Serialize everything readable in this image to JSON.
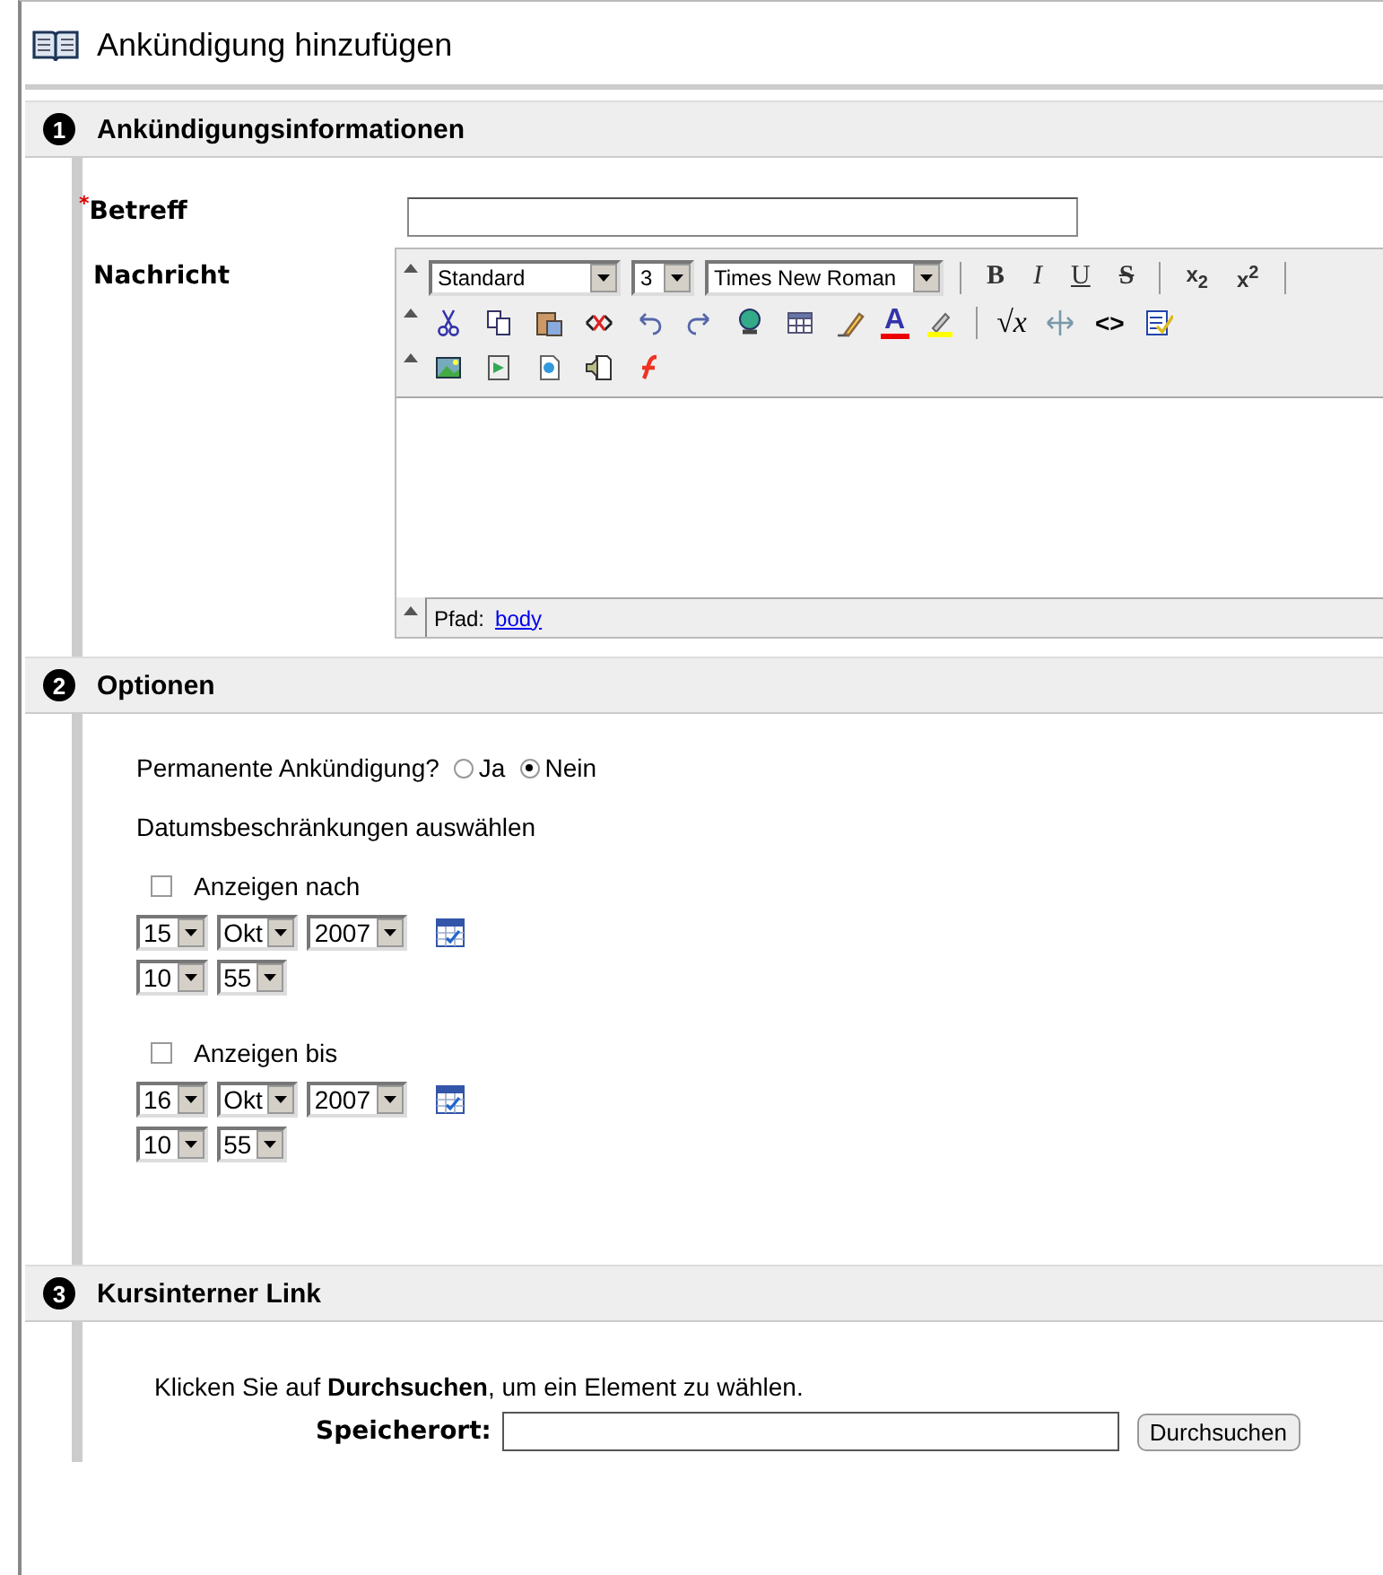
{
  "page": {
    "title": "Ankündigung hinzufügen"
  },
  "sections": [
    {
      "number": "1",
      "title": "Ankündigungsinformationen"
    },
    {
      "number": "2",
      "title": "Optionen"
    },
    {
      "number": "3",
      "title": "Kursinterner Link"
    }
  ],
  "info": {
    "subject": {
      "label": "Betreff",
      "required_mark": "*"
    },
    "message": {
      "label": "Nachricht",
      "format_selects": [
        {
          "value": "Standard"
        },
        {
          "value": "3"
        },
        {
          "value": "Times New Roman"
        }
      ],
      "style_buttons": [
        {
          "kind": "bold",
          "label": "B"
        },
        {
          "kind": "italic",
          "label": "I"
        },
        {
          "kind": "underline",
          "label": "U"
        },
        {
          "kind": "strike",
          "label": "S"
        },
        {
          "kind": "sep"
        },
        {
          "kind": "script",
          "label": "x$_{2}$"
        },
        {
          "kind": "script",
          "label": "x$^{2}$"
        }
      ],
      "row2": [
        {
          "kind": "cut"
        },
        {
          "kind": "copy"
        },
        {
          "kind": "paste"
        },
        {
          "kind": "remove"
        },
        {
          "kind": "undo"
        },
        {
          "kind": "redo"
        },
        {
          "kind": "link"
        },
        {
          "kind": "table"
        },
        {
          "kind": "pen"
        },
        {
          "kind": "fontcolor",
          "label": "A"
        },
        {
          "kind": "highlight"
        },
        {
          "kind": "sep"
        },
        {
          "kind": "math",
          "label": "√x"
        },
        {
          "kind": "anchor"
        },
        {
          "kind": "code",
          "label": "<>"
        },
        {
          "kind": "spell"
        }
      ],
      "row3": [
        {
          "kind": "image"
        },
        {
          "kind": "media"
        },
        {
          "kind": "preview"
        },
        {
          "kind": "audio"
        },
        {
          "kind": "flash"
        }
      ],
      "path_label": "Pfad:",
      "path_link": "body"
    }
  },
  "options": {
    "permanent_label": "Permanente Ankündigung?",
    "permanent_choices": [
      {
        "label": "Ja",
        "selected": false
      },
      {
        "label": "Nein",
        "selected": true
      }
    ],
    "date_heading": "Datumsbeschränkungen auswählen",
    "date_limits": [
      {
        "label": "Anzeigen nach",
        "checked": false,
        "day": "15",
        "month": "Okt",
        "year": "2007",
        "hour": "10",
        "minute": "55"
      },
      {
        "label": "Anzeigen bis",
        "checked": false,
        "day": "16",
        "month": "Okt",
        "year": "2007",
        "hour": "10",
        "minute": "55"
      }
    ]
  },
  "link": {
    "instruction": "Klicken Sie auf **Durchsuchen**, um ein Element zu wählen.",
    "location_label": "Speicherort:",
    "browse_button": "Durchsuchen"
  }
}
